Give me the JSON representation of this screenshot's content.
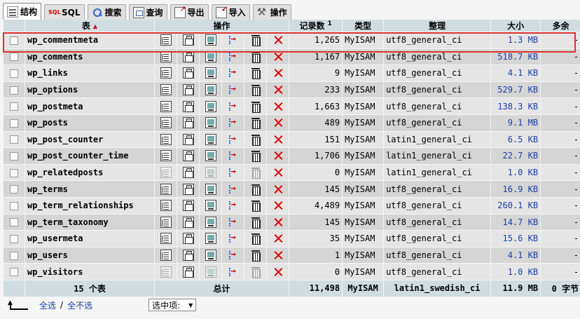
{
  "tabs": [
    {
      "label": "结构",
      "icon": "structure-icon",
      "active": true
    },
    {
      "label": "SQL",
      "icon": "sql-icon"
    },
    {
      "label": "搜索",
      "icon": "search-icon"
    },
    {
      "label": "查询",
      "icon": "query-icon"
    },
    {
      "label": "导出",
      "icon": "export-icon"
    },
    {
      "label": "导入",
      "icon": "import-icon"
    },
    {
      "label": "操作",
      "icon": "operations-icon"
    }
  ],
  "header": {
    "table": "表",
    "actions": "操作",
    "records": "记录数",
    "records_note": "1",
    "type": "类型",
    "collation": "整理",
    "size": "大小",
    "overhead": "多余"
  },
  "rows": [
    {
      "name": "wp_commentmeta",
      "records": "1,265",
      "type": "MyISAM",
      "collation": "utf8_general_ci",
      "size": "1.3 MB",
      "overhead": "-",
      "empty": false
    },
    {
      "name": "wp_comments",
      "records": "1,167",
      "type": "MyISAM",
      "collation": "utf8_general_ci",
      "size": "518.7 KB",
      "overhead": "-",
      "empty": false
    },
    {
      "name": "wp_links",
      "records": "9",
      "type": "MyISAM",
      "collation": "utf8_general_ci",
      "size": "4.1 KB",
      "overhead": "-",
      "empty": false
    },
    {
      "name": "wp_options",
      "records": "233",
      "type": "MyISAM",
      "collation": "utf8_general_ci",
      "size": "529.7 KB",
      "overhead": "-",
      "empty": false
    },
    {
      "name": "wp_postmeta",
      "records": "1,663",
      "type": "MyISAM",
      "collation": "utf8_general_ci",
      "size": "138.3 KB",
      "overhead": "-",
      "empty": false
    },
    {
      "name": "wp_posts",
      "records": "489",
      "type": "MyISAM",
      "collation": "utf8_general_ci",
      "size": "9.1 MB",
      "overhead": "-",
      "empty": false
    },
    {
      "name": "wp_post_counter",
      "records": "151",
      "type": "MyISAM",
      "collation": "latin1_general_ci",
      "size": "6.5 KB",
      "overhead": "-",
      "empty": false
    },
    {
      "name": "wp_post_counter_time",
      "records": "1,706",
      "type": "MyISAM",
      "collation": "latin1_general_ci",
      "size": "22.7 KB",
      "overhead": "-",
      "empty": false
    },
    {
      "name": "wp_relatedposts",
      "records": "0",
      "type": "MyISAM",
      "collation": "latin1_general_ci",
      "size": "1.0 KB",
      "overhead": "-",
      "empty": true
    },
    {
      "name": "wp_terms",
      "records": "145",
      "type": "MyISAM",
      "collation": "utf8_general_ci",
      "size": "16.9 KB",
      "overhead": "-",
      "empty": false
    },
    {
      "name": "wp_term_relationships",
      "records": "4,489",
      "type": "MyISAM",
      "collation": "utf8_general_ci",
      "size": "260.1 KB",
      "overhead": "-",
      "empty": false
    },
    {
      "name": "wp_term_taxonomy",
      "records": "145",
      "type": "MyISAM",
      "collation": "utf8_general_ci",
      "size": "14.7 KB",
      "overhead": "-",
      "empty": false
    },
    {
      "name": "wp_usermeta",
      "records": "35",
      "type": "MyISAM",
      "collation": "utf8_general_ci",
      "size": "15.6 KB",
      "overhead": "-",
      "empty": false
    },
    {
      "name": "wp_users",
      "records": "1",
      "type": "MyISAM",
      "collation": "utf8_general_ci",
      "size": "4.1 KB",
      "overhead": "-",
      "empty": false
    },
    {
      "name": "wp_visitors",
      "records": "0",
      "type": "MyISAM",
      "collation": "utf8_general_ci",
      "size": "1.0 KB",
      "overhead": "-",
      "empty": true
    }
  ],
  "footer": {
    "tables_count": "15 个表",
    "total_label": "总计",
    "records": "11,498",
    "type": "MyISAM",
    "collation": "latin1_swedish_ci",
    "size": "11.9 MB",
    "overhead": "0 字节"
  },
  "controls": {
    "check_all": "全选",
    "separator": "/",
    "uncheck_all": "全不选",
    "with_selected": "选中项:"
  },
  "action_icons": [
    "browse-icon",
    "structure-icon",
    "search-icon",
    "insert-icon",
    "empty-icon",
    "drop-icon"
  ],
  "colors": {
    "header_bg": "#d0dce0",
    "row_odd": "#e5e5e5",
    "row_even": "#d5d5d5",
    "highlight": "#e03030",
    "link": "#1a3faa"
  }
}
